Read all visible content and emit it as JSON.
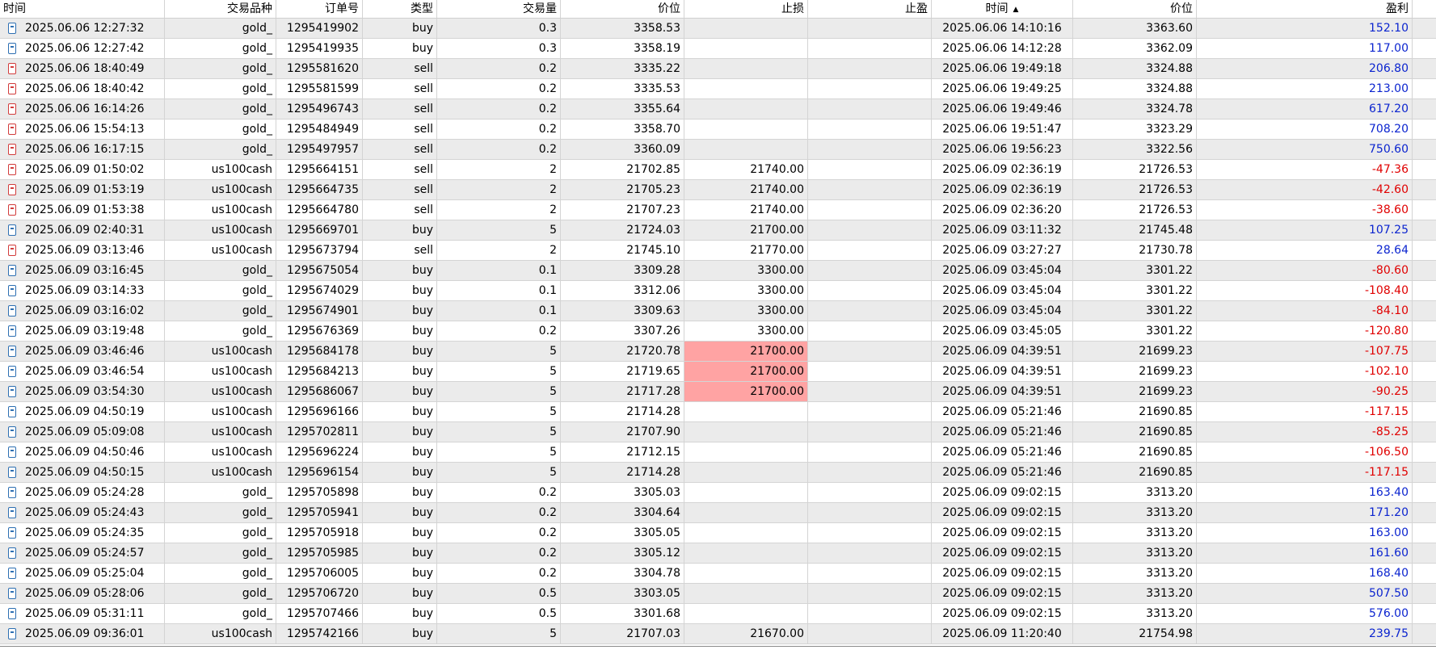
{
  "headers": [
    "时间",
    "交易品种",
    "订单号",
    "类型",
    "交易量",
    "价位",
    "止损",
    "止盈",
    "时间",
    "价位",
    "盈利"
  ],
  "rows": [
    {
      "open_time": "2025.06.06 12:27:32",
      "symbol": "gold_",
      "order": "1295419902",
      "type": "buy",
      "volume": "0.3",
      "open_price": "3358.53",
      "sl": "",
      "tp": "",
      "close_time": "2025.06.06 14:10:16",
      "close_price": "3363.60",
      "profit": "152.10",
      "sl_hit": false
    },
    {
      "open_time": "2025.06.06 12:27:42",
      "symbol": "gold_",
      "order": "1295419935",
      "type": "buy",
      "volume": "0.3",
      "open_price": "3358.19",
      "sl": "",
      "tp": "",
      "close_time": "2025.06.06 14:12:28",
      "close_price": "3362.09",
      "profit": "117.00",
      "sl_hit": false
    },
    {
      "open_time": "2025.06.06 18:40:49",
      "symbol": "gold_",
      "order": "1295581620",
      "type": "sell",
      "volume": "0.2",
      "open_price": "3335.22",
      "sl": "",
      "tp": "",
      "close_time": "2025.06.06 19:49:18",
      "close_price": "3324.88",
      "profit": "206.80",
      "sl_hit": false
    },
    {
      "open_time": "2025.06.06 18:40:42",
      "symbol": "gold_",
      "order": "1295581599",
      "type": "sell",
      "volume": "0.2",
      "open_price": "3335.53",
      "sl": "",
      "tp": "",
      "close_time": "2025.06.06 19:49:25",
      "close_price": "3324.88",
      "profit": "213.00",
      "sl_hit": false
    },
    {
      "open_time": "2025.06.06 16:14:26",
      "symbol": "gold_",
      "order": "1295496743",
      "type": "sell",
      "volume": "0.2",
      "open_price": "3355.64",
      "sl": "",
      "tp": "",
      "close_time": "2025.06.06 19:49:46",
      "close_price": "3324.78",
      "profit": "617.20",
      "sl_hit": false
    },
    {
      "open_time": "2025.06.06 15:54:13",
      "symbol": "gold_",
      "order": "1295484949",
      "type": "sell",
      "volume": "0.2",
      "open_price": "3358.70",
      "sl": "",
      "tp": "",
      "close_time": "2025.06.06 19:51:47",
      "close_price": "3323.29",
      "profit": "708.20",
      "sl_hit": false
    },
    {
      "open_time": "2025.06.06 16:17:15",
      "symbol": "gold_",
      "order": "1295497957",
      "type": "sell",
      "volume": "0.2",
      "open_price": "3360.09",
      "sl": "",
      "tp": "",
      "close_time": "2025.06.06 19:56:23",
      "close_price": "3322.56",
      "profit": "750.60",
      "sl_hit": false
    },
    {
      "open_time": "2025.06.09 01:50:02",
      "symbol": "us100cash",
      "order": "1295664151",
      "type": "sell",
      "volume": "2",
      "open_price": "21702.85",
      "sl": "21740.00",
      "tp": "",
      "close_time": "2025.06.09 02:36:19",
      "close_price": "21726.53",
      "profit": "-47.36",
      "sl_hit": false
    },
    {
      "open_time": "2025.06.09 01:53:19",
      "symbol": "us100cash",
      "order": "1295664735",
      "type": "sell",
      "volume": "2",
      "open_price": "21705.23",
      "sl": "21740.00",
      "tp": "",
      "close_time": "2025.06.09 02:36:19",
      "close_price": "21726.53",
      "profit": "-42.60",
      "sl_hit": false
    },
    {
      "open_time": "2025.06.09 01:53:38",
      "symbol": "us100cash",
      "order": "1295664780",
      "type": "sell",
      "volume": "2",
      "open_price": "21707.23",
      "sl": "21740.00",
      "tp": "",
      "close_time": "2025.06.09 02:36:20",
      "close_price": "21726.53",
      "profit": "-38.60",
      "sl_hit": false
    },
    {
      "open_time": "2025.06.09 02:40:31",
      "symbol": "us100cash",
      "order": "1295669701",
      "type": "buy",
      "volume": "5",
      "open_price": "21724.03",
      "sl": "21700.00",
      "tp": "",
      "close_time": "2025.06.09 03:11:32",
      "close_price": "21745.48",
      "profit": "107.25",
      "sl_hit": false
    },
    {
      "open_time": "2025.06.09 03:13:46",
      "symbol": "us100cash",
      "order": "1295673794",
      "type": "sell",
      "volume": "2",
      "open_price": "21745.10",
      "sl": "21770.00",
      "tp": "",
      "close_time": "2025.06.09 03:27:27",
      "close_price": "21730.78",
      "profit": "28.64",
      "sl_hit": false
    },
    {
      "open_time": "2025.06.09 03:16:45",
      "symbol": "gold_",
      "order": "1295675054",
      "type": "buy",
      "volume": "0.1",
      "open_price": "3309.28",
      "sl": "3300.00",
      "tp": "",
      "close_time": "2025.06.09 03:45:04",
      "close_price": "3301.22",
      "profit": "-80.60",
      "sl_hit": false
    },
    {
      "open_time": "2025.06.09 03:14:33",
      "symbol": "gold_",
      "order": "1295674029",
      "type": "buy",
      "volume": "0.1",
      "open_price": "3312.06",
      "sl": "3300.00",
      "tp": "",
      "close_time": "2025.06.09 03:45:04",
      "close_price": "3301.22",
      "profit": "-108.40",
      "sl_hit": false
    },
    {
      "open_time": "2025.06.09 03:16:02",
      "symbol": "gold_",
      "order": "1295674901",
      "type": "buy",
      "volume": "0.1",
      "open_price": "3309.63",
      "sl": "3300.00",
      "tp": "",
      "close_time": "2025.06.09 03:45:04",
      "close_price": "3301.22",
      "profit": "-84.10",
      "sl_hit": false
    },
    {
      "open_time": "2025.06.09 03:19:48",
      "symbol": "gold_",
      "order": "1295676369",
      "type": "buy",
      "volume": "0.2",
      "open_price": "3307.26",
      "sl": "3300.00",
      "tp": "",
      "close_time": "2025.06.09 03:45:05",
      "close_price": "3301.22",
      "profit": "-120.80",
      "sl_hit": false
    },
    {
      "open_time": "2025.06.09 03:46:46",
      "symbol": "us100cash",
      "order": "1295684178",
      "type": "buy",
      "volume": "5",
      "open_price": "21720.78",
      "sl": "21700.00",
      "tp": "",
      "close_time": "2025.06.09 04:39:51",
      "close_price": "21699.23",
      "profit": "-107.75",
      "sl_hit": true
    },
    {
      "open_time": "2025.06.09 03:46:54",
      "symbol": "us100cash",
      "order": "1295684213",
      "type": "buy",
      "volume": "5",
      "open_price": "21719.65",
      "sl": "21700.00",
      "tp": "",
      "close_time": "2025.06.09 04:39:51",
      "close_price": "21699.23",
      "profit": "-102.10",
      "sl_hit": true
    },
    {
      "open_time": "2025.06.09 03:54:30",
      "symbol": "us100cash",
      "order": "1295686067",
      "type": "buy",
      "volume": "5",
      "open_price": "21717.28",
      "sl": "21700.00",
      "tp": "",
      "close_time": "2025.06.09 04:39:51",
      "close_price": "21699.23",
      "profit": "-90.25",
      "sl_hit": true
    },
    {
      "open_time": "2025.06.09 04:50:19",
      "symbol": "us100cash",
      "order": "1295696166",
      "type": "buy",
      "volume": "5",
      "open_price": "21714.28",
      "sl": "",
      "tp": "",
      "close_time": "2025.06.09 05:21:46",
      "close_price": "21690.85",
      "profit": "-117.15",
      "sl_hit": false
    },
    {
      "open_time": "2025.06.09 05:09:08",
      "symbol": "us100cash",
      "order": "1295702811",
      "type": "buy",
      "volume": "5",
      "open_price": "21707.90",
      "sl": "",
      "tp": "",
      "close_time": "2025.06.09 05:21:46",
      "close_price": "21690.85",
      "profit": "-85.25",
      "sl_hit": false
    },
    {
      "open_time": "2025.06.09 04:50:46",
      "symbol": "us100cash",
      "order": "1295696224",
      "type": "buy",
      "volume": "5",
      "open_price": "21712.15",
      "sl": "",
      "tp": "",
      "close_time": "2025.06.09 05:21:46",
      "close_price": "21690.85",
      "profit": "-106.50",
      "sl_hit": false
    },
    {
      "open_time": "2025.06.09 04:50:15",
      "symbol": "us100cash",
      "order": "1295696154",
      "type": "buy",
      "volume": "5",
      "open_price": "21714.28",
      "sl": "",
      "tp": "",
      "close_time": "2025.06.09 05:21:46",
      "close_price": "21690.85",
      "profit": "-117.15",
      "sl_hit": false
    },
    {
      "open_time": "2025.06.09 05:24:28",
      "symbol": "gold_",
      "order": "1295705898",
      "type": "buy",
      "volume": "0.2",
      "open_price": "3305.03",
      "sl": "",
      "tp": "",
      "close_time": "2025.06.09 09:02:15",
      "close_price": "3313.20",
      "profit": "163.40",
      "sl_hit": false
    },
    {
      "open_time": "2025.06.09 05:24:43",
      "symbol": "gold_",
      "order": "1295705941",
      "type": "buy",
      "volume": "0.2",
      "open_price": "3304.64",
      "sl": "",
      "tp": "",
      "close_time": "2025.06.09 09:02:15",
      "close_price": "3313.20",
      "profit": "171.20",
      "sl_hit": false
    },
    {
      "open_time": "2025.06.09 05:24:35",
      "symbol": "gold_",
      "order": "1295705918",
      "type": "buy",
      "volume": "0.2",
      "open_price": "3305.05",
      "sl": "",
      "tp": "",
      "close_time": "2025.06.09 09:02:15",
      "close_price": "3313.20",
      "profit": "163.00",
      "sl_hit": false
    },
    {
      "open_time": "2025.06.09 05:24:57",
      "symbol": "gold_",
      "order": "1295705985",
      "type": "buy",
      "volume": "0.2",
      "open_price": "3305.12",
      "sl": "",
      "tp": "",
      "close_time": "2025.06.09 09:02:15",
      "close_price": "3313.20",
      "profit": "161.60",
      "sl_hit": false
    },
    {
      "open_time": "2025.06.09 05:25:04",
      "symbol": "gold_",
      "order": "1295706005",
      "type": "buy",
      "volume": "0.2",
      "open_price": "3304.78",
      "sl": "",
      "tp": "",
      "close_time": "2025.06.09 09:02:15",
      "close_price": "3313.20",
      "profit": "168.40",
      "sl_hit": false
    },
    {
      "open_time": "2025.06.09 05:28:06",
      "symbol": "gold_",
      "order": "1295706720",
      "type": "buy",
      "volume": "0.5",
      "open_price": "3303.05",
      "sl": "",
      "tp": "",
      "close_time": "2025.06.09 09:02:15",
      "close_price": "3313.20",
      "profit": "507.50",
      "sl_hit": false
    },
    {
      "open_time": "2025.06.09 05:31:11",
      "symbol": "gold_",
      "order": "1295707466",
      "type": "buy",
      "volume": "0.5",
      "open_price": "3301.68",
      "sl": "",
      "tp": "",
      "close_time": "2025.06.09 09:02:15",
      "close_price": "3313.20",
      "profit": "576.00",
      "sl_hit": false
    },
    {
      "open_time": "2025.06.09 09:36:01",
      "symbol": "us100cash",
      "order": "1295742166",
      "type": "buy",
      "volume": "5",
      "open_price": "21707.03",
      "sl": "21670.00",
      "tp": "",
      "close_time": "2025.06.09 11:20:40",
      "close_price": "21754.98",
      "profit": "239.75",
      "sl_hit": false
    }
  ],
  "colors": {
    "profit_positive": "#0b24cf",
    "profit_negative": "#e00000",
    "sl_hit_bg": "#ffa3a3",
    "row_alt_bg": "#ebebeb"
  },
  "icons": {
    "buy": "order-doc-icon-blue",
    "sell": "order-doc-icon-red"
  }
}
